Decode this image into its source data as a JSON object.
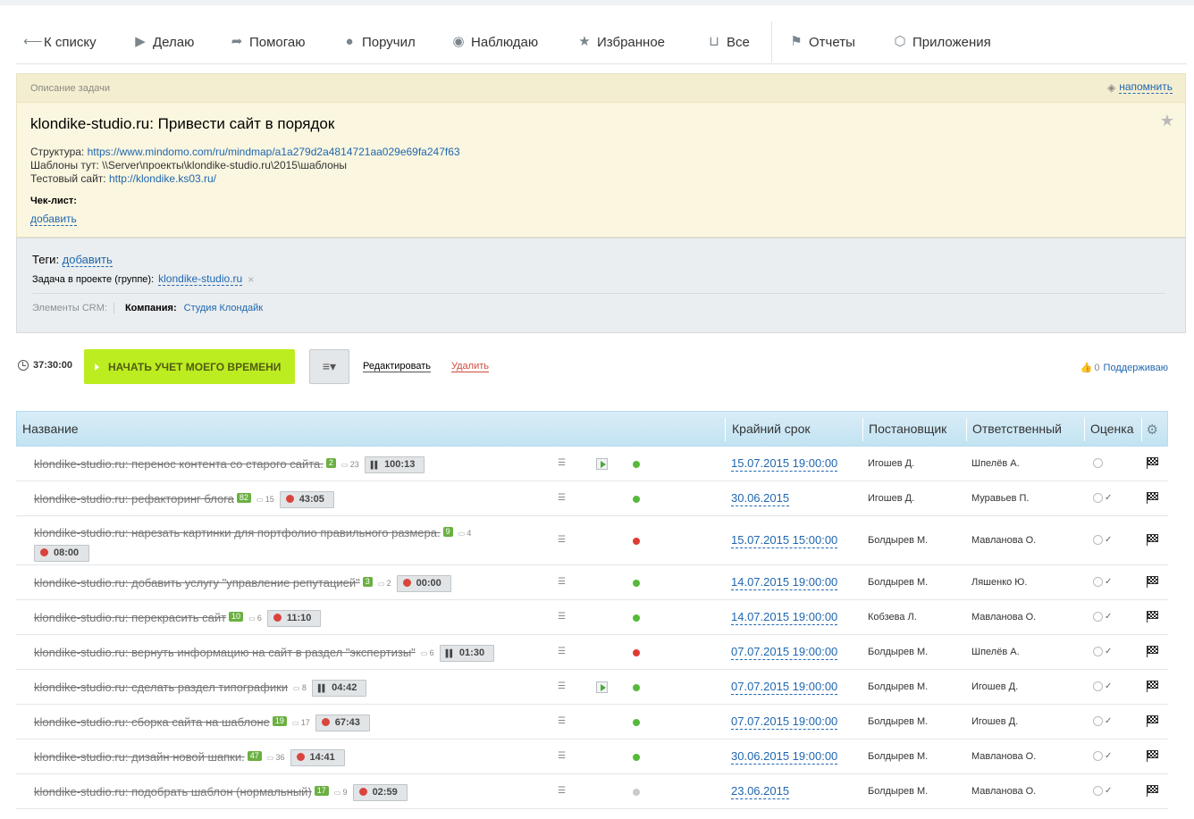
{
  "nav": {
    "back": "К списку",
    "items": [
      {
        "label": "Делаю",
        "icon": "play-icon"
      },
      {
        "label": "Помогаю",
        "icon": "share-arrow-icon"
      },
      {
        "label": "Поручил",
        "icon": "person-icon"
      },
      {
        "label": "Наблюдаю",
        "icon": "eye-icon"
      },
      {
        "label": "Избранное",
        "icon": "star-icon"
      },
      {
        "label": "Все",
        "icon": "inbox-icon"
      },
      {
        "label": "Отчеты",
        "icon": "flag-icon"
      },
      {
        "label": "Приложения",
        "icon": "cube-icon"
      }
    ]
  },
  "description": {
    "header": "Описание задачи",
    "remind": "напомнить",
    "title": "klondike-studio.ru: Привести сайт в порядок",
    "structure_label": "Структура: ",
    "structure_link": "https://www.mindomo.com/ru/mindmap/a1a279d2a4814721aa029e69fa247f63",
    "templates_line": "Шаблоны тут: \\\\Server\\проекты\\klondike-studio.ru\\2015\\шаблоны",
    "test_label": "Тестовый сайт: ",
    "test_link": "http://klondike.ks03.ru/",
    "checklist_label": "Чек-лист:",
    "checklist_add": "добавить"
  },
  "tags": {
    "tags_label": "Теги: ",
    "tags_add": "добавить",
    "project_label": "Задача в проекте (группе):",
    "project_value": "klondike-studio.ru",
    "crm_label": "Элементы CRM:",
    "crm_company_label": "Компания:",
    "crm_company_value": "Студия Клондайк"
  },
  "actions": {
    "timer": "37:30:00",
    "start_button": "НАЧАТЬ УЧЕТ МОЕГО ВРЕМЕНИ",
    "edit": "Редактировать",
    "delete": "Удалить",
    "support_count": "0",
    "support_label": "Поддерживаю"
  },
  "table": {
    "headers": {
      "name": "Название",
      "deadline": "Крайний срок",
      "creator": "Постановщик",
      "responsible": "Ответственный",
      "mark": "Оценка"
    },
    "rows": [
      {
        "title": "klondike-studio.ru: перенос контента со старого сайта.",
        "badge": "2",
        "comments": "23",
        "time": "100:13",
        "timer_state": "paused",
        "play": true,
        "status_color": "#57b93b",
        "deadline": "15.07.2015 19:00:00",
        "creator": "Игошев Д.",
        "responsible": "Шпелёв А.",
        "mark": ""
      },
      {
        "title": "klondike-studio.ru: рефакторинг блога",
        "badge": "82",
        "comments": "15",
        "time": "43:05",
        "timer_state": "clock",
        "play": false,
        "status_color": "#57b93b",
        "deadline": "30.06.2015",
        "creator": "Игошев Д.",
        "responsible": "Муравьев П.",
        "mark": "✓"
      },
      {
        "title": "klondike-studio.ru: нарезать картинки для портфолио правильного размера.",
        "badge": "9",
        "comments": "4",
        "time": "08:00",
        "timer_state": "clock",
        "play": false,
        "status_color": "#e03a35",
        "deadline": "15.07.2015 15:00:00",
        "creator": "Болдырев М.",
        "responsible": "Мавланова О.",
        "mark": "✓"
      },
      {
        "title": "klondike-studio.ru: добавить услугу \"управление репутацией\"",
        "badge": "3",
        "comments": "2",
        "time": "00:00",
        "timer_state": "clock",
        "play": false,
        "status_color": "#57b93b",
        "deadline": "14.07.2015 19:00:00",
        "creator": "Болдырев М.",
        "responsible": "Ляшенко Ю.",
        "mark": "✓"
      },
      {
        "title": "klondike-studio.ru: перекрасить сайт",
        "badge": "10",
        "comments": "6",
        "time": "11:10",
        "timer_state": "clock",
        "play": false,
        "status_color": "#57b93b",
        "deadline": "14.07.2015 19:00:00",
        "creator": "Кобзева Л.",
        "responsible": "Мавланова О.",
        "mark": "✓"
      },
      {
        "title": "klondike-studio.ru: вернуть информацию на сайт в раздел \"экспертизы\"",
        "badge": "",
        "comments": "6",
        "time": "01:30",
        "timer_state": "paused",
        "play": false,
        "status_color": "#e03a35",
        "deadline": "07.07.2015 19:00:00",
        "creator": "Болдырев М.",
        "responsible": "Шпелёв А.",
        "mark": "✓"
      },
      {
        "title": "klondike-studio.ru: сделать раздел типографики",
        "badge": "",
        "comments": "8",
        "time": "04:42",
        "timer_state": "paused",
        "play": true,
        "status_color": "#57b93b",
        "deadline": "07.07.2015 19:00:00",
        "creator": "Болдырев М.",
        "responsible": "Игошев Д.",
        "mark": "✓"
      },
      {
        "title": "klondike-studio.ru: сборка сайта на шаблоне",
        "badge": "19",
        "comments": "17",
        "time": "67:43",
        "timer_state": "clock",
        "play": false,
        "status_color": "#57b93b",
        "deadline": "07.07.2015 19:00:00",
        "creator": "Болдырев М.",
        "responsible": "Игошев Д.",
        "mark": "✓"
      },
      {
        "title": "klondike-studio.ru: дизайн новой шапки.",
        "badge": "47",
        "comments": "36",
        "time": "14:41",
        "timer_state": "clock",
        "play": false,
        "status_color": "#57b93b",
        "deadline": "30.06.2015 19:00:00",
        "creator": "Болдырев М.",
        "responsible": "Мавланова О.",
        "mark": "✓"
      },
      {
        "title": "klondike-studio.ru: подобрать шаблон (нормальный)",
        "badge": "17",
        "comments": "9",
        "time": "02:59",
        "timer_state": "clock",
        "play": false,
        "status_color": "#c8cbcd",
        "deadline": "23.06.2015",
        "creator": "Болдырев М.",
        "responsible": "Мавланова О.",
        "mark": "✓"
      }
    ]
  }
}
